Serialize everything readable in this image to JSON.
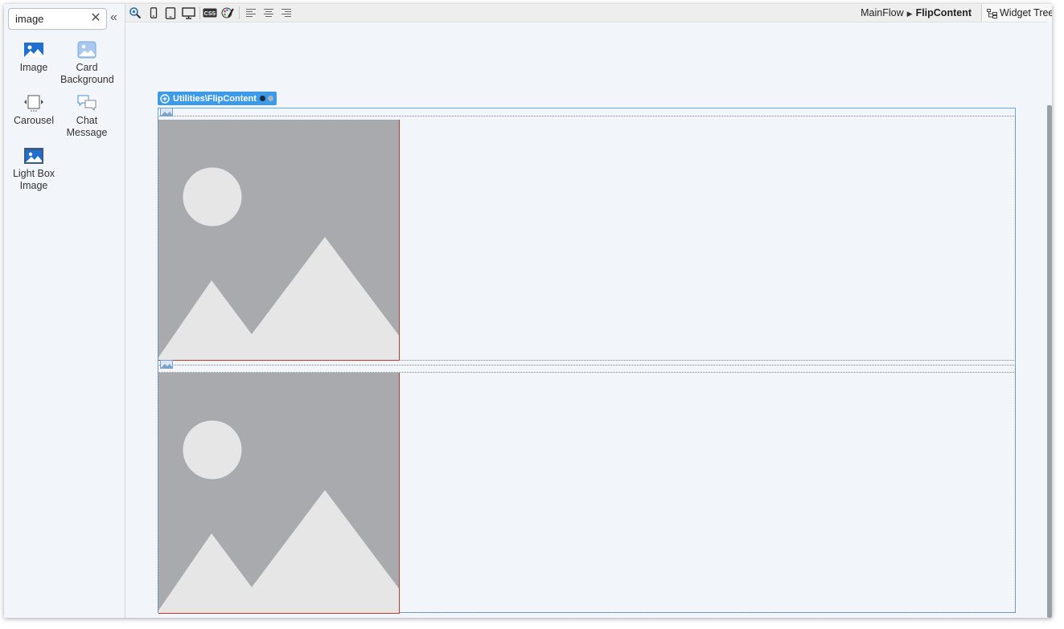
{
  "search": {
    "value": "image",
    "clear_icon": "close-icon"
  },
  "widgets": [
    {
      "label": "Image",
      "icon": "image-icon"
    },
    {
      "label": "Card\nBackground",
      "icon": "card-background-icon"
    },
    {
      "label": "Carousel",
      "icon": "carousel-icon"
    },
    {
      "label": "Chat\nMessage",
      "icon": "chat-message-icon"
    },
    {
      "label": "Light Box\nImage",
      "icon": "lightbox-image-icon"
    }
  ],
  "toolbar": {
    "icons": [
      "preview-icon",
      "phone-icon",
      "tablet-icon",
      "desktop-icon",
      "css-icon",
      "theme-icon",
      "align-left-icon",
      "align-center-icon",
      "align-right-icon"
    ]
  },
  "breadcrumb": {
    "parent": "MainFlow",
    "current": "FlipContent"
  },
  "widget_tree": {
    "label": "Widget Tree"
  },
  "canvas": {
    "block_label": "Utilities\\FlipContent",
    "images": [
      {
        "name": "front-image"
      },
      {
        "name": "back-image"
      }
    ]
  },
  "colors": {
    "accent": "#3d9ae8",
    "image_bg": "#a9aaad",
    "image_fg": "#e6e6e6",
    "selection_border": "#c0392b"
  }
}
